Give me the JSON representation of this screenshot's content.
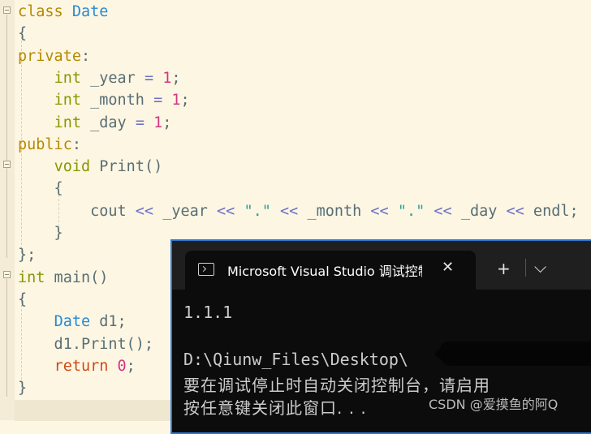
{
  "editor": {
    "lines": [
      {
        "id": "l1",
        "parts": [
          [
            "kw2",
            "class "
          ],
          [
            "ty",
            "Date"
          ]
        ]
      },
      {
        "id": "l2",
        "parts": [
          [
            "pl",
            "{"
          ]
        ]
      },
      {
        "id": "l3",
        "parts": [
          [
            "kw2",
            "private"
          ],
          [
            "pl",
            ":"
          ]
        ]
      },
      {
        "id": "l4",
        "parts": [
          [
            "pl",
            "    "
          ],
          [
            "kw",
            "int"
          ],
          [
            "pl",
            " _year "
          ],
          [
            "op",
            "="
          ],
          [
            "pl",
            " "
          ],
          [
            "num",
            "1"
          ],
          [
            "pl",
            ";"
          ]
        ]
      },
      {
        "id": "l5",
        "parts": [
          [
            "pl",
            "    "
          ],
          [
            "kw",
            "int"
          ],
          [
            "pl",
            " _month "
          ],
          [
            "op",
            "="
          ],
          [
            "pl",
            " "
          ],
          [
            "num",
            "1"
          ],
          [
            "pl",
            ";"
          ]
        ]
      },
      {
        "id": "l6",
        "parts": [
          [
            "pl",
            "    "
          ],
          [
            "kw",
            "int"
          ],
          [
            "pl",
            " _day "
          ],
          [
            "op",
            "="
          ],
          [
            "pl",
            " "
          ],
          [
            "num",
            "1"
          ],
          [
            "pl",
            ";"
          ]
        ]
      },
      {
        "id": "l7",
        "parts": [
          [
            "kw2",
            "public"
          ],
          [
            "pl",
            ":"
          ]
        ]
      },
      {
        "id": "l8",
        "parts": [
          [
            "pl",
            "    "
          ],
          [
            "kw",
            "void"
          ],
          [
            "pl",
            " Print()"
          ]
        ]
      },
      {
        "id": "l9",
        "parts": [
          [
            "pl",
            "    {"
          ]
        ]
      },
      {
        "id": "l10",
        "parts": [
          [
            "pl",
            "        cout "
          ],
          [
            "op",
            "<<"
          ],
          [
            "pl",
            " _year "
          ],
          [
            "op",
            "<<"
          ],
          [
            "pl",
            " "
          ],
          [
            "str",
            "\".\""
          ],
          [
            "pl",
            " "
          ],
          [
            "op",
            "<<"
          ],
          [
            "pl",
            " _month "
          ],
          [
            "op",
            "<<"
          ],
          [
            "pl",
            " "
          ],
          [
            "str",
            "\".\""
          ],
          [
            "pl",
            " "
          ],
          [
            "op",
            "<<"
          ],
          [
            "pl",
            " _day "
          ],
          [
            "op",
            "<<"
          ],
          [
            "pl",
            " endl;"
          ]
        ]
      },
      {
        "id": "l11",
        "parts": [
          [
            "pl",
            "    }"
          ]
        ]
      },
      {
        "id": "l12",
        "parts": [
          [
            "pl",
            "};"
          ]
        ]
      },
      {
        "id": "l13",
        "parts": [
          [
            "kw",
            "int"
          ],
          [
            "pl",
            " main()"
          ]
        ]
      },
      {
        "id": "l14",
        "parts": [
          [
            "pl",
            "{"
          ]
        ]
      },
      {
        "id": "l15",
        "parts": [
          [
            "pl",
            "    "
          ],
          [
            "ty",
            "Date"
          ],
          [
            "pl",
            " d1;"
          ]
        ]
      },
      {
        "id": "l16",
        "parts": [
          [
            "pl",
            "    d1.Print();"
          ]
        ]
      },
      {
        "id": "l17",
        "parts": [
          [
            "pl",
            "    "
          ],
          [
            "ret",
            "return"
          ],
          [
            "pl",
            " "
          ],
          [
            "num",
            "0"
          ],
          [
            "pl",
            ";"
          ]
        ]
      },
      {
        "id": "l18",
        "parts": [
          [
            "pl",
            "}"
          ]
        ]
      }
    ]
  },
  "terminal": {
    "tab_title": "Microsoft Visual Studio 调试控制台",
    "close_glyph": "✕",
    "new_tab_glyph": "+",
    "dropdown_glyph": "⌵",
    "output": {
      "line1": "1.1.1",
      "line2": "D:\\Qiunw_Files\\Desktop\\",
      "line3": "要在调试停止时自动关闭控制台，请启用",
      "line4": "按任意键关闭此窗口. . ."
    }
  },
  "watermark": "CSDN @爱摸鱼的阿Q"
}
